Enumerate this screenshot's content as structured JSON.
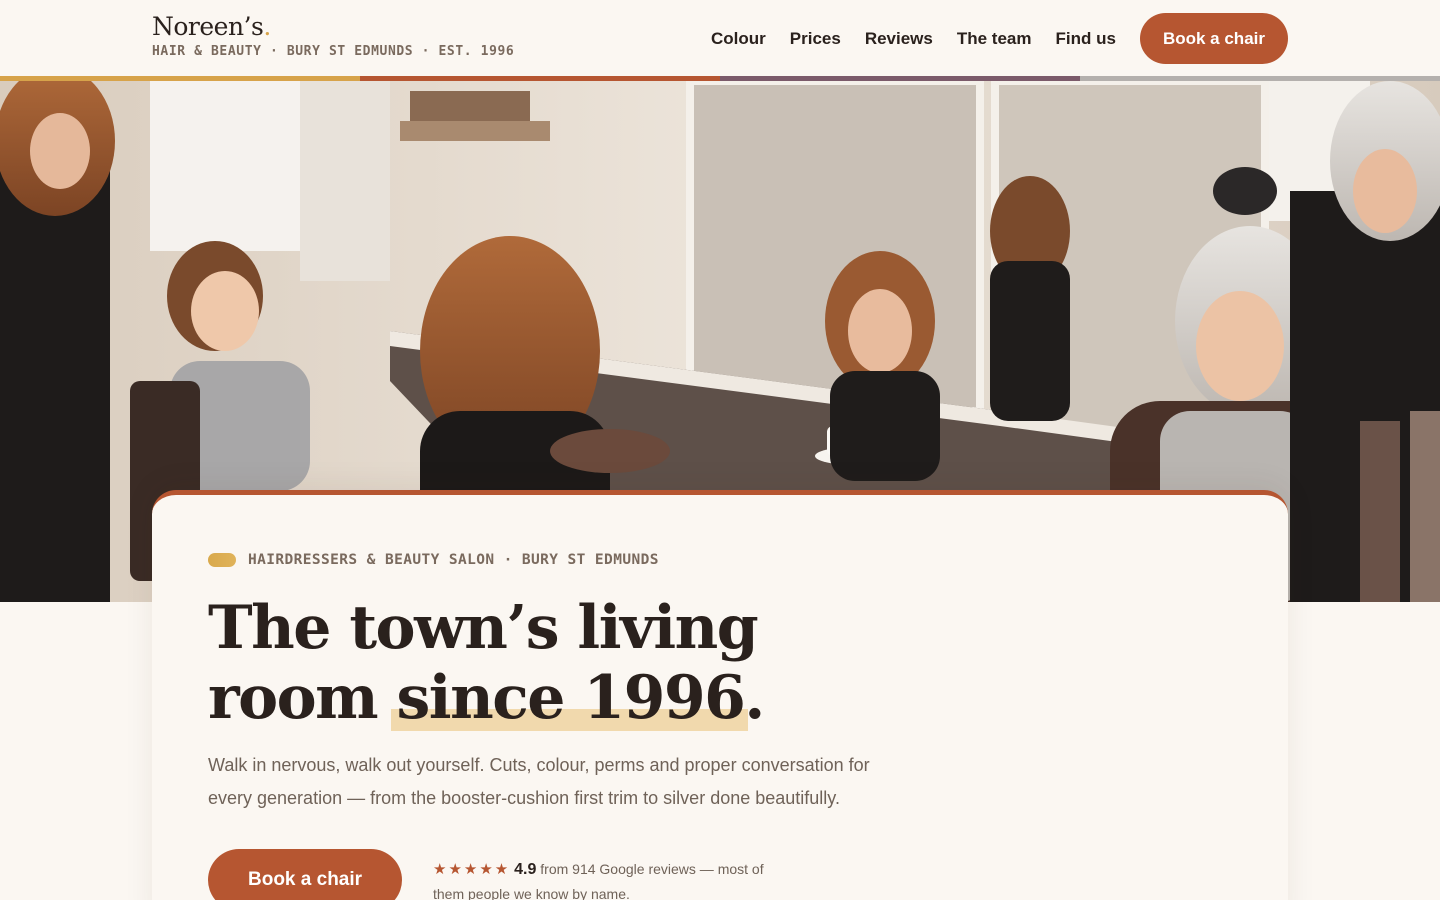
{
  "brand": {
    "name": "Noreen’s",
    "dot": ".",
    "tagline": "HAIR & BEAUTY · BURY ST EDMUNDS · EST. 1996"
  },
  "nav": {
    "items": [
      "Colour",
      "Prices",
      "Reviews",
      "The team",
      "Find us"
    ],
    "cta": "Book a chair"
  },
  "stripe_colors": [
    "#d7a34a",
    "#b65631",
    "#7b5a6a",
    "#b4b0ad"
  ],
  "hero": {
    "photo_icon": "salon-photo"
  },
  "card": {
    "eyebrow": "HAIRDRESSERS & BEAUTY SALON · BURY ST EDMUNDS",
    "headline_line1": "The town’s living",
    "headline_room": "room",
    "headline_highlight": "since 1996",
    "headline_period": ".",
    "lede": "Walk in nervous, walk out yourself. Cuts, colour, perms and proper conversation for every generation — from the booster-cushion first trim to silver done beautifully.",
    "cta": "Book a chair",
    "stars": "★★★★★",
    "score": "4.9",
    "rating_text": "from 914 Google reviews — most of them people we know by name."
  },
  "colors": {
    "accent": "#b65631",
    "gold": "#d7a34a",
    "ink": "#2a211d",
    "muted": "#7a6a5e",
    "paper": "#fbf7f2",
    "highlight": "#f1d9ad"
  }
}
